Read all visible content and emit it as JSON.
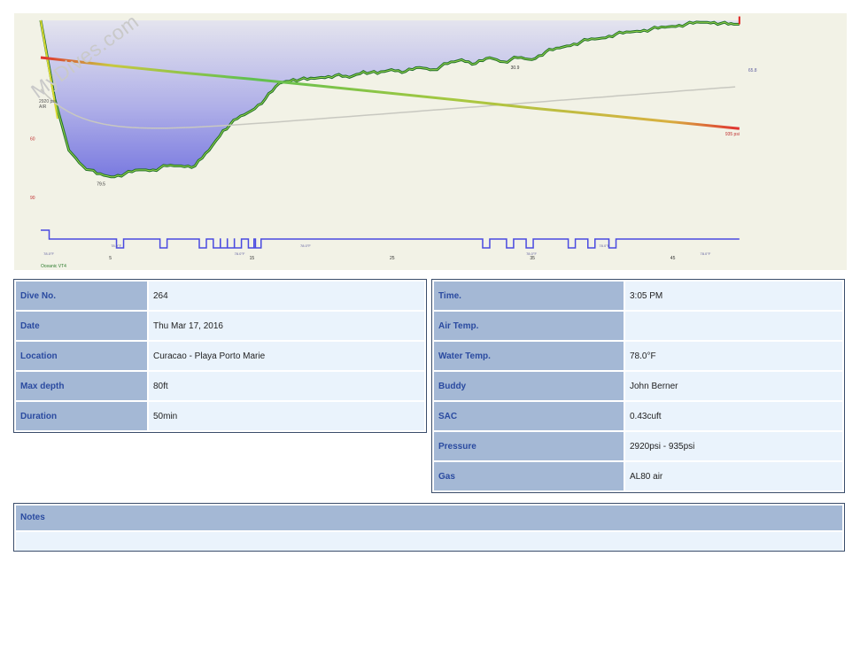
{
  "watermark": "MyDives.com",
  "chart_data": {
    "type": "line",
    "title": "",
    "xlabel": "",
    "ylabel": "",
    "x_unit": "min",
    "y_unit": "ft",
    "xlim": [
      0,
      50
    ],
    "ylim": [
      0,
      90
    ],
    "x_ticks": [
      "5",
      "15",
      "25",
      "35",
      "45"
    ],
    "y_ticks": [
      "60",
      "90"
    ],
    "max_depth_label": "79.5",
    "depth_label_2": "30.9",
    "start_pressure_label": "2920 psi",
    "end_pressure_label": "935 psi",
    "air_label": "AIR",
    "temp_label": "65.8",
    "computer_label": "Oceanic VT4",
    "temp_marks": [
      "78.0°F",
      "78.0°F",
      "78.0°F",
      "78.0°F",
      "78.0°F",
      "78.0°F",
      "78.0°F"
    ],
    "series": [
      {
        "name": "Depth",
        "x": [
          0,
          1,
          2,
          3,
          4,
          5,
          6,
          7,
          8,
          9,
          10,
          11,
          12,
          13,
          14,
          15,
          16,
          17,
          18,
          19,
          20,
          21,
          22,
          23,
          24,
          25,
          26,
          27,
          28,
          29,
          30,
          31,
          32,
          33,
          34,
          35,
          36,
          37,
          38,
          39,
          40,
          41,
          42,
          43,
          44,
          45,
          46,
          47,
          48,
          49,
          49.8
        ],
        "values": [
          0,
          40,
          66,
          74,
          78,
          79.5,
          78,
          76,
          76,
          74,
          74,
          74,
          66,
          56,
          50,
          46,
          40,
          32,
          30,
          30,
          29,
          28,
          29,
          26,
          27,
          25,
          26,
          24,
          25,
          22,
          20,
          22,
          19,
          21,
          19,
          20,
          16,
          14,
          12,
          10,
          9,
          7,
          6,
          5,
          4,
          3,
          2,
          1,
          1,
          2,
          2
        ]
      },
      {
        "name": "Pressure",
        "x": [
          0,
          5,
          10,
          15,
          20,
          25,
          30,
          35,
          40,
          45,
          49.8
        ],
        "values": [
          2920,
          2700,
          2500,
          2320,
          2120,
          1920,
          1720,
          1510,
          1320,
          1120,
          935
        ]
      },
      {
        "name": "Temperature",
        "x": [
          0,
          5,
          10,
          15,
          20,
          25,
          30,
          35,
          40,
          45,
          49.8
        ],
        "values": [
          0.05,
          0.02,
          -0.01,
          0.05,
          0.15,
          0.25,
          0.35,
          0.45,
          0.55,
          0.65,
          0.75
        ]
      }
    ]
  },
  "left_table": [
    {
      "label": "Dive No.",
      "value": "264"
    },
    {
      "label": "Date",
      "value": "Thu Mar 17, 2016"
    },
    {
      "label": "Location",
      "value": "Curacao - Playa Porto Marie"
    },
    {
      "label": "Max depth",
      "value": "80ft"
    },
    {
      "label": "Duration",
      "value": "50min"
    }
  ],
  "right_table": [
    {
      "label": "Time.",
      "value": "3:05 PM"
    },
    {
      "label": "Air Temp.",
      "value": ""
    },
    {
      "label": "Water Temp.",
      "value": "78.0°F"
    },
    {
      "label": "Buddy",
      "value": "John Berner"
    },
    {
      "label": "SAC",
      "value": "0.43cuft"
    },
    {
      "label": "Pressure",
      "value": "2920psi - 935psi"
    },
    {
      "label": "Gas",
      "value": "AL80 air"
    }
  ],
  "notes": {
    "label": "Notes",
    "value": ""
  },
  "colors": {
    "label_bg": "#a4b8d5",
    "label_text": "#2a4aa0",
    "value_bg": "#eaf3fc",
    "profile_fill": "#8585e0",
    "plot_bg": "#f2f2e6"
  }
}
